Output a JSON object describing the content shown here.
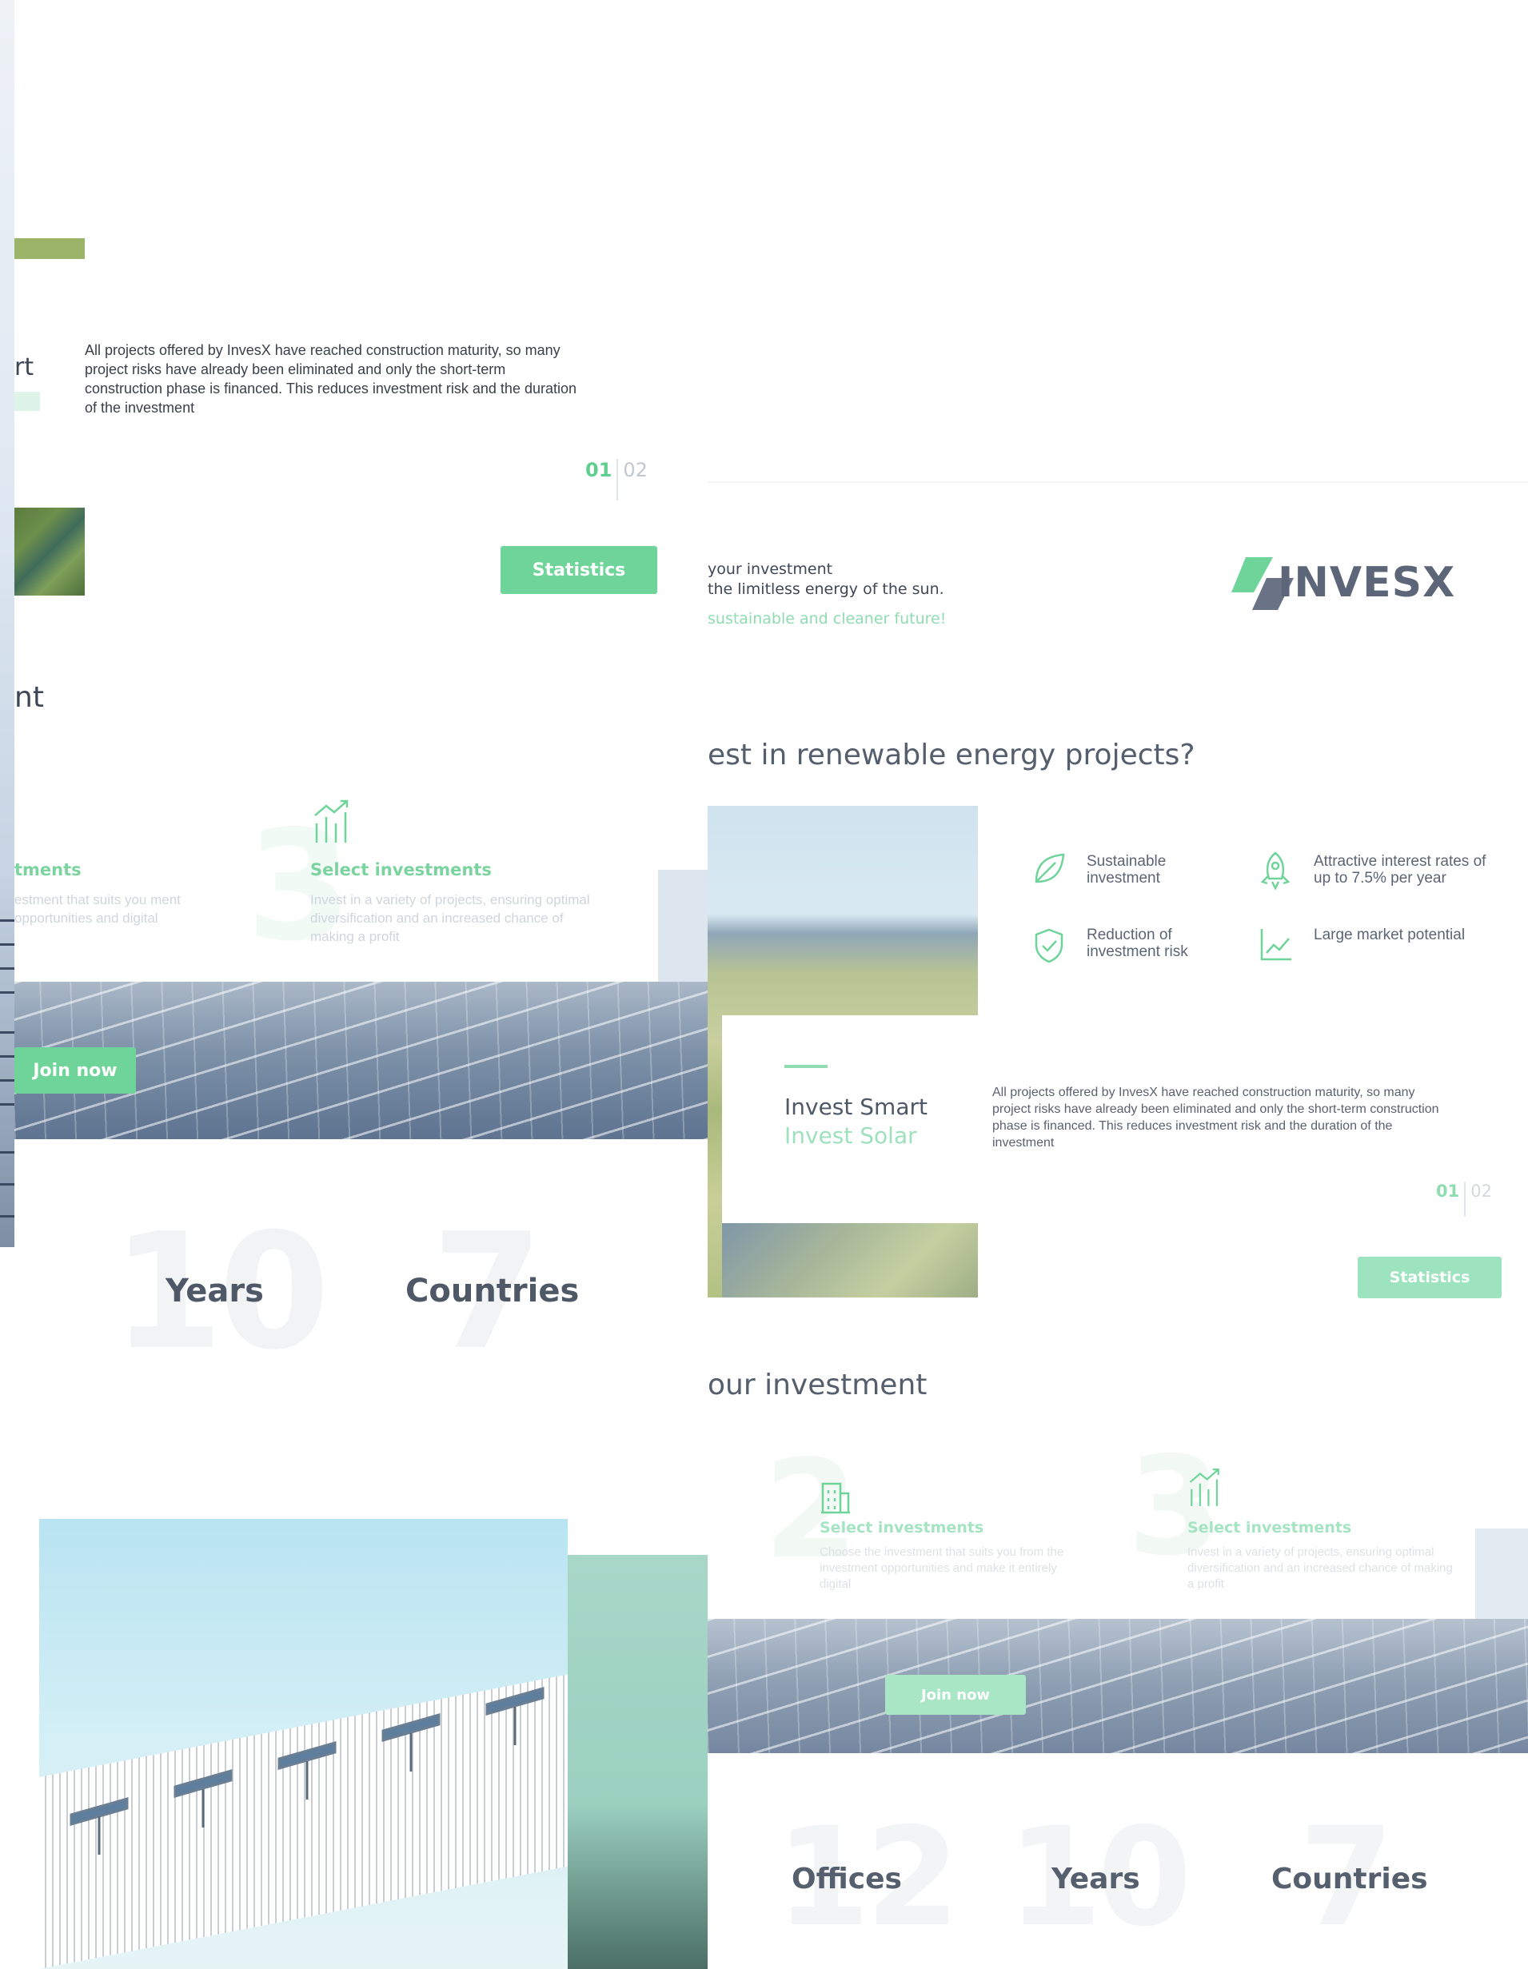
{
  "left": {
    "heading_fragment_1": "rt",
    "heading_fragment_2": "nt",
    "body": "All projects offered by InvesX have reached construction maturity, so many project risks have already been eliminated and only the short-term construction phase is financed. This reduces investment risk and the duration of the investment",
    "pager": {
      "current": "01",
      "next": "02"
    },
    "statistics_button": "Statistics",
    "features": [
      {
        "title": "tments",
        "desc": "estment that suits you ment opportunities and  digital"
      },
      {
        "number": "3",
        "title": "Select investments",
        "desc": "Invest in a variety of projects, ensuring optimal diversification and an increased chance of making a profit",
        "icon": "chart-up-icon"
      }
    ],
    "join_button": "Join now",
    "stats": [
      {
        "number": "10",
        "label": "Years"
      },
      {
        "number": "7",
        "label": "Countries"
      }
    ]
  },
  "right": {
    "intro_line_1": "your investment",
    "intro_line_2": "the limitless energy of the sun.",
    "intro_line_3": "sustainable and cleaner future!",
    "logo": "INVESX",
    "question": "est in renewable energy projects?",
    "benefits": [
      {
        "icon": "leaf-icon",
        "label": "Sustainable investment"
      },
      {
        "icon": "rocket-icon",
        "label": "Attractive interest rates of up to 7.5% per year"
      },
      {
        "icon": "shield-check-icon",
        "label": "Reduction of investment risk"
      },
      {
        "icon": "trend-chart-icon",
        "label": "Large market potential"
      }
    ],
    "card_title_1": "Invest Smart",
    "card_title_2": "Invest Solar",
    "card_body": "All projects offered by InvesX have reached construction maturity, so many project risks have already been eliminated and only the short-term construction phase is financed. This reduces investment risk and the duration of the investment",
    "pager": {
      "current": "01",
      "next": "02"
    },
    "statistics_button": "Statistics",
    "section_title": "our investment",
    "steps": [
      {
        "number": "2",
        "icon": "building-icon",
        "title": "Select investments",
        "desc": "Choose the investment that suits you from the investment opportunities and make it entirely digital"
      },
      {
        "number": "3",
        "icon": "chart-up-icon",
        "title": "Select investments",
        "desc": "Invest in a variety of projects, ensuring optimal diversification and an increased chance of making a profit"
      }
    ],
    "join_button": "Join now",
    "stats": [
      {
        "number": "12",
        "label": "Offices"
      },
      {
        "number": "10",
        "label": "Years"
      },
      {
        "number": "7",
        "label": "Countries"
      }
    ]
  },
  "colors": {
    "accent": "#6fd49a",
    "text": "#3f4a5a",
    "muted": "#cfd5dc"
  }
}
